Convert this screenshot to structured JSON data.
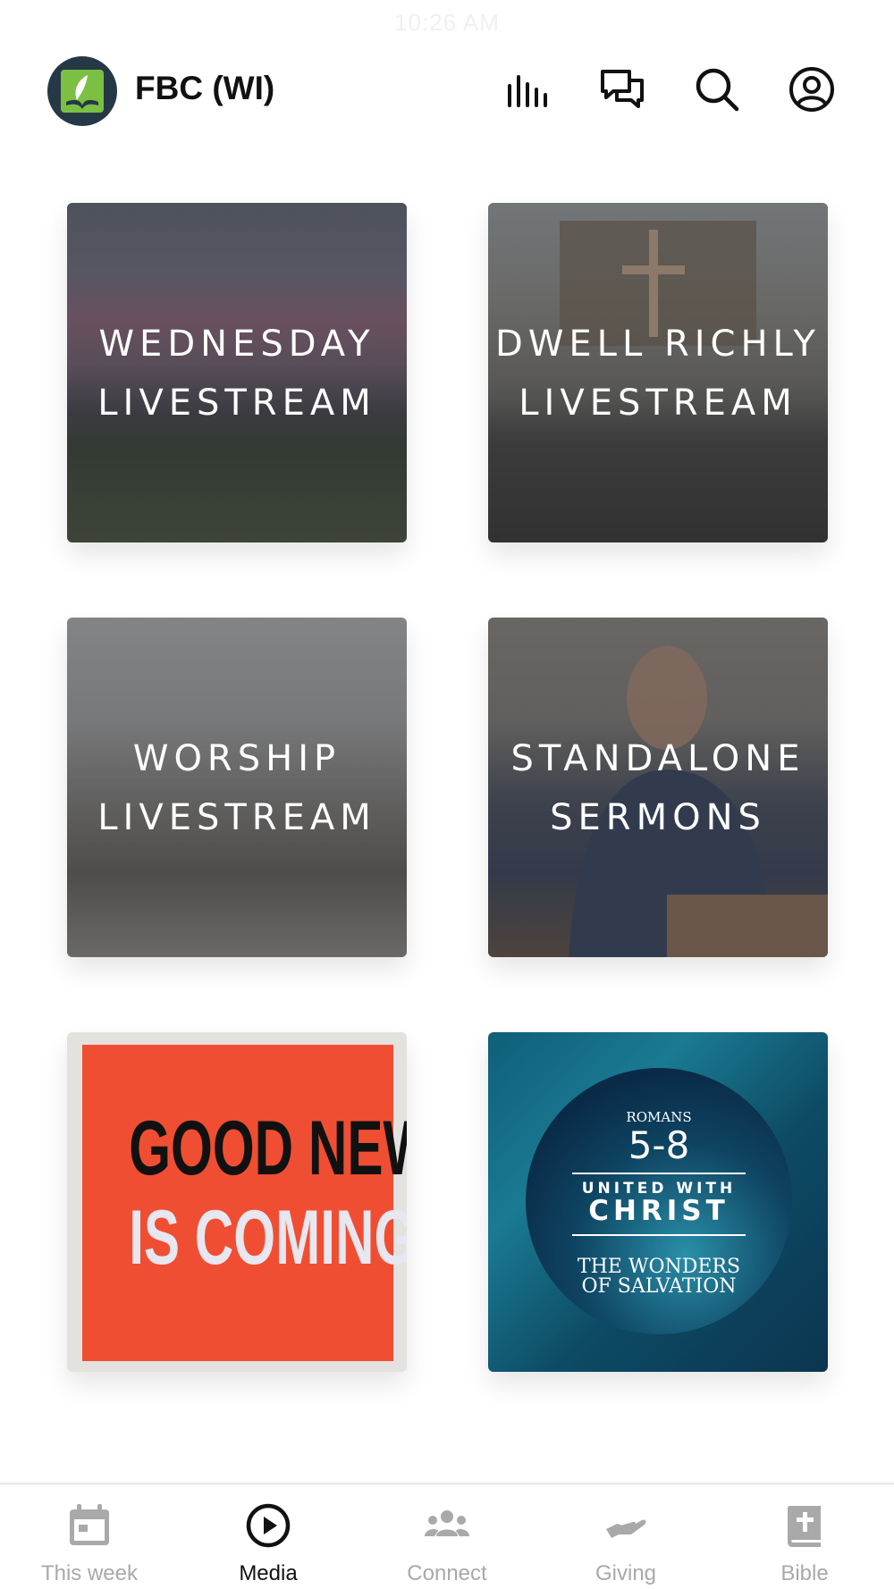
{
  "status_bar": {
    "time": "10:26 AM"
  },
  "header": {
    "title": "FBC (WI)",
    "icons": [
      "equalizer-icon",
      "chat-icon",
      "search-icon",
      "account-icon"
    ]
  },
  "tiles": [
    {
      "line1": "WEDNESDAY",
      "line2": "LIVESTREAM"
    },
    {
      "line1": "DWELL RICHLY",
      "line2": "LIVESTREAM"
    },
    {
      "line1": "WORSHIP",
      "line2": "LIVESTREAM"
    },
    {
      "line1": "STANDALONE",
      "line2": "SERMONS"
    },
    {
      "line1": "GOOD NEWS",
      "line2": "IS COMING"
    },
    {
      "kicker": "ROMANS",
      "chapters": "5-8",
      "united": "UNITED WITH",
      "christ": "CHRIST",
      "subtitle1": "THE WONDERS",
      "subtitle2": "OF SALVATION"
    }
  ],
  "tabbar": {
    "active": "Media",
    "tabs": [
      {
        "label": "This week",
        "icon": "calendar-icon"
      },
      {
        "label": "Media",
        "icon": "play-icon"
      },
      {
        "label": "Connect",
        "icon": "group-icon"
      },
      {
        "label": "Giving",
        "icon": "giving-hand-icon"
      },
      {
        "label": "Bible",
        "icon": "bible-icon"
      }
    ]
  },
  "colors": {
    "accent": "#111111",
    "inactive": "#a9a9a9",
    "logo_bg": "#263846",
    "logo_green": "#7bc043",
    "poster_red": "#f04e32"
  }
}
